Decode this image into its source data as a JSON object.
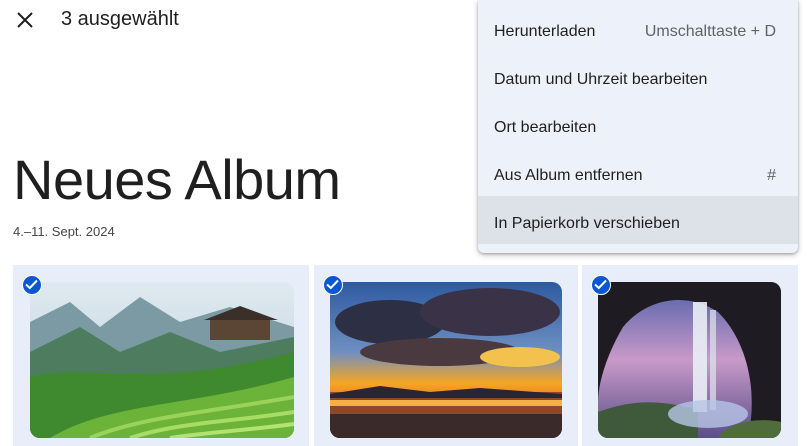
{
  "header": {
    "close_icon": "close-icon",
    "selection_label": "3 ausgewählt"
  },
  "album": {
    "title": "Neues Album",
    "date_range": "4.–11. Sept. 2024"
  },
  "photos": [
    {
      "name": "rice-terraces",
      "selected": true
    },
    {
      "name": "sunset-lake",
      "selected": true
    },
    {
      "name": "waterfall-cave",
      "selected": true
    }
  ],
  "menu": {
    "items": [
      {
        "label": "Herunterladen",
        "shortcut": "Umschalttaste + D"
      },
      {
        "label": "Datum und Uhrzeit bearbeiten",
        "shortcut": ""
      },
      {
        "label": "Ort bearbeiten",
        "shortcut": ""
      },
      {
        "label": "Aus Album entfernen",
        "shortcut": "#"
      },
      {
        "label": "In Papierkorb verschieben",
        "shortcut": ""
      }
    ]
  },
  "colors": {
    "accent": "#0b57d0",
    "menu_bg": "#edf1f9",
    "menu_hover": "#dde1e8",
    "tile_bg": "#e8eef9"
  }
}
